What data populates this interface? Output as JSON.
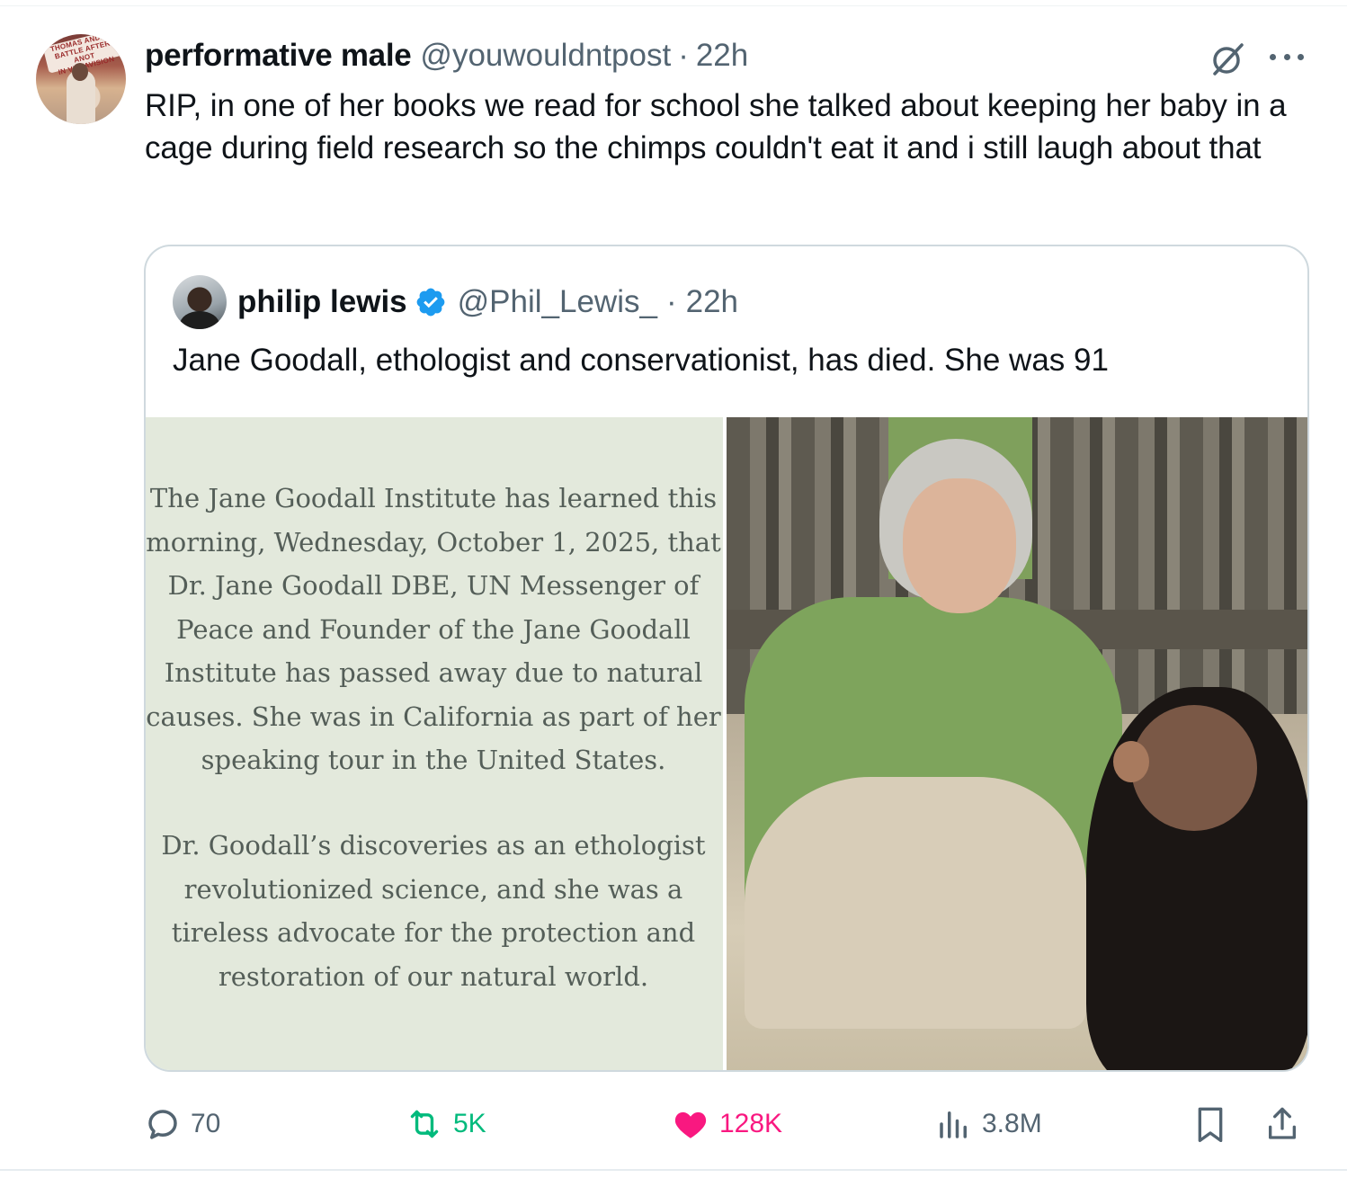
{
  "tweet": {
    "display_name": "performative male",
    "handle": "@youwouldntpost",
    "separator": "·",
    "time": "22h",
    "text": "RIP, in one of her books we read for school she talked about keeping her baby in a cage during field research so the chimps couldn't eat it and i still laugh about that",
    "avatar_sign_lines": [
      "THOMAS ANDER",
      "BATTLE AFTER ANOT",
      "IN VISTAVISION"
    ]
  },
  "quote": {
    "display_name": "philip lewis",
    "verified": true,
    "handle": "@Phil_Lewis_",
    "separator": "·",
    "time": "22h",
    "text": "Jane Goodall, ethologist and conservationist, has died. She was 91",
    "statement_paragraph_1": "The Jane Goodall Institute has learned this morning, Wednesday, October 1, 2025, that Dr. Jane Goodall DBE, UN Messenger of Peace and Founder of the Jane Goodall Institute has passed away due to natural causes. She was in California as part of her speaking tour in the United States.",
    "statement_paragraph_2": "Dr. Goodall’s discoveries as an ethologist revolutionized science, and she was a tireless advocate for the protection and restoration of our natural world."
  },
  "actions": {
    "replies": "70",
    "reposts": "5K",
    "likes": "128K",
    "views": "3.8M"
  },
  "icons": [
    "grok-icon",
    "more-icon",
    "verified-icon",
    "reply-icon",
    "retweet-icon",
    "heart-icon",
    "views-icon",
    "bookmark-icon",
    "share-icon"
  ],
  "colors": {
    "text": "#0f1419",
    "secondary": "#536471",
    "border": "#cfd9de",
    "verified": "#1d9bf0",
    "repost": "#00ba7c",
    "like": "#f91880",
    "statement_bg": "#e3e9dc"
  }
}
